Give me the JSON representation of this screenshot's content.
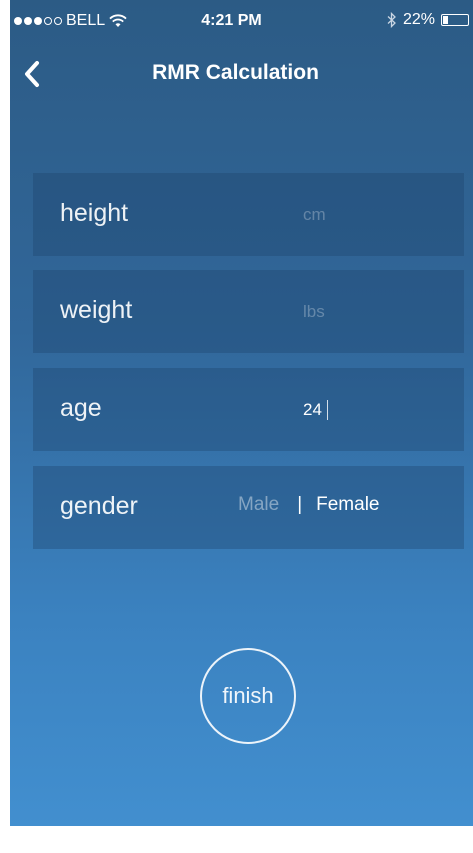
{
  "status_bar": {
    "carrier": "BELL",
    "time": "4:21 PM",
    "battery_text": "22%",
    "battery_level": 0.22,
    "signal_bars_filled": 3,
    "signal_bars_total": 5
  },
  "nav": {
    "title": "RMR Calculation",
    "back_icon": "chevron-left-icon"
  },
  "form": {
    "height": {
      "label": "height",
      "placeholder": "cm",
      "value": ""
    },
    "weight": {
      "label": "weight",
      "placeholder": "lbs",
      "value": ""
    },
    "age": {
      "label": "age",
      "placeholder": "",
      "value": "24"
    },
    "gender": {
      "label": "gender",
      "option_male": "Male",
      "separator": "|",
      "option_female": "Female",
      "selected": "Female"
    }
  },
  "finish_label": "finish",
  "colors": {
    "background_top": "#2c5b85",
    "background_bottom": "#428fcf",
    "text": "#ffffff"
  }
}
